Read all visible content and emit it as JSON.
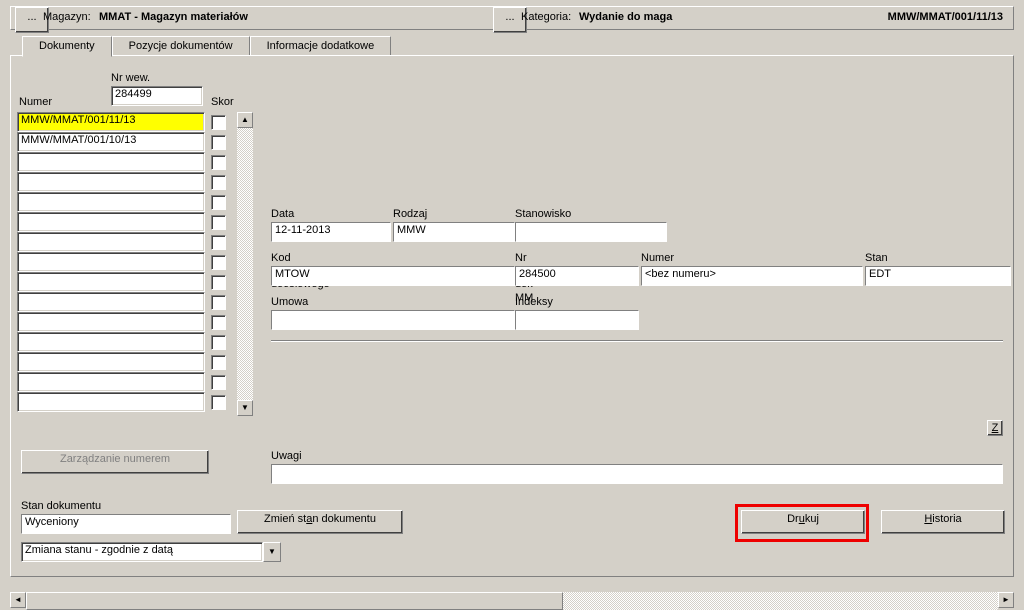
{
  "header": {
    "magazyn_label": "Magazyn:",
    "magazyn_value": "MMAT - Magazyn materiałów",
    "kategoria_label": "Kategoria:",
    "kategoria_value": "Wydanie do maga",
    "doc_number": "MMW/MMAT/001/11/13"
  },
  "tabs": {
    "t1": "Dokumenty",
    "t2": "Pozycje dokumentów",
    "t3": "Informacje dodatkowe"
  },
  "list": {
    "numer_label": "Numer",
    "nrwew_label": "Nr wew.",
    "nrwew_value": "284499",
    "skor_label": "Skor",
    "rows": [
      "MMW/MMAT/001/11/13",
      "MMW/MMAT/001/10/13",
      "",
      "",
      "",
      "",
      "",
      "",
      "",
      "",
      "",
      "",
      "",
      "",
      ""
    ]
  },
  "details": {
    "data_wyst_label": "Data wystawienia",
    "data_wyst_value": "12-11-2013",
    "rodzaj_label": "Rodzaj dokumentu",
    "rodzaj_value": "MMW",
    "stanowisko_label": "Stanowisko kosztów",
    "stanowisko_value": "",
    "kod_mag_label": "Kod magazynu docelowego",
    "kod_mag_value": "MTOW",
    "nrwew_mm_label": "Nr wew. dok MM",
    "nrwew_mm_value": "284500",
    "numer_mm_label": "Numer MM",
    "numer_mm_value": "<bez numeru>",
    "stan_mm_label": "Stan MM",
    "stan_mm_value": "EDT",
    "umowa_label": "Umowa",
    "umowa_value": "",
    "indeksy_label": "Indeksy obce",
    "indeksy_value": "",
    "z_btn": "Z",
    "uwagi_label": "Uwagi",
    "uwagi_value": ""
  },
  "bottom": {
    "zarz_numerem": "Zarządzanie numerem",
    "stan_dok_label": "Stan dokumentu",
    "stan_dok_value": "Wyceniony",
    "zmien_stan": "Zmień stan dokumentu",
    "zmien_stan_mnemonic": "a",
    "dropdown_value": "Zmiana stanu - zgodnie z datą",
    "drukuj": "Drukuj",
    "drukuj_mnemonic": "u",
    "historia": "Historia",
    "historia_mnemonic": "H"
  }
}
